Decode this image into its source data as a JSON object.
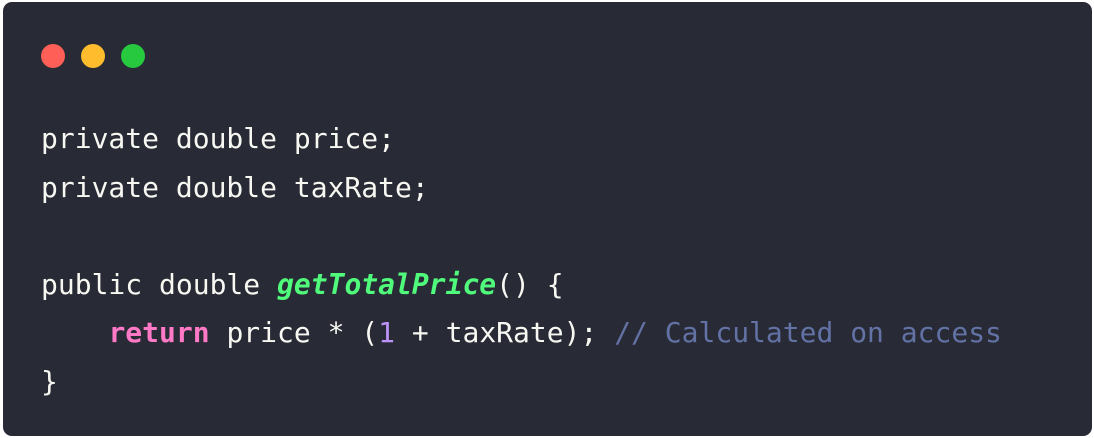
{
  "window": {
    "controls": [
      {
        "name": "close",
        "color": "#ff5f56"
      },
      {
        "name": "minimize",
        "color": "#ffbd2e"
      },
      {
        "name": "maximize",
        "color": "#27c93f"
      }
    ]
  },
  "code": {
    "line1": "private double price;",
    "line2": "private double taxRate;",
    "line3": "",
    "line4_pre": "public double ",
    "line4_fn": "getTotalPrice",
    "line4_post": "() {",
    "line5_indent": "    ",
    "line5_kw": "return",
    "line5_mid": " price * (",
    "line5_num": "1",
    "line5_rest": " + taxRate); ",
    "line5_comment": "// Calculated on access",
    "line6": "}"
  },
  "colors": {
    "background": "#282a36",
    "text": "#f8f8f2",
    "function": "#50fa7b",
    "keyword": "#ff79c6",
    "number": "#bd93f9",
    "comment": "#6272a4"
  }
}
